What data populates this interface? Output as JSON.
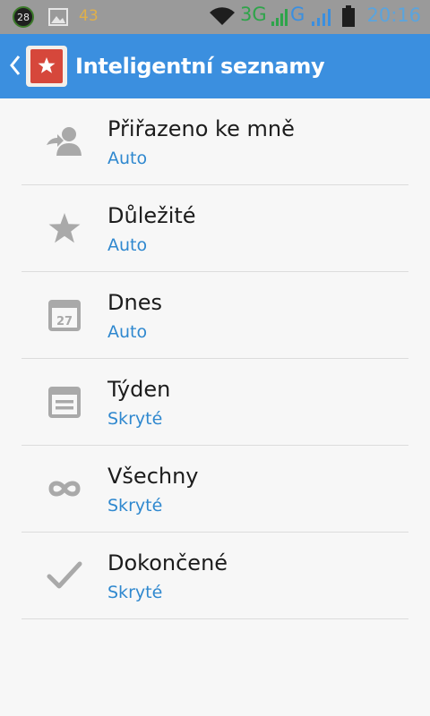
{
  "status_bar": {
    "notification_count": "28",
    "battery_level_text": "43",
    "network_3g": "3G",
    "network_g": "G",
    "time": "20:16"
  },
  "app_bar": {
    "title": "Inteligentní seznamy"
  },
  "list": {
    "items": [
      {
        "title": "Přiřazeno ke mně",
        "subtitle": "Auto",
        "icon": "assigned-to-me-icon"
      },
      {
        "title": "Důležité",
        "subtitle": "Auto",
        "icon": "star-icon"
      },
      {
        "title": "Dnes",
        "subtitle": "Auto",
        "icon": "calendar-today-icon",
        "icon_text": "27"
      },
      {
        "title": "Týden",
        "subtitle": "Skryté",
        "icon": "calendar-week-icon"
      },
      {
        "title": "Všechny",
        "subtitle": "Skryté",
        "icon": "infinity-icon"
      },
      {
        "title": "Dokončené",
        "subtitle": "Skryté",
        "icon": "checkmark-icon"
      }
    ]
  },
  "colors": {
    "status_bar": "#9a9a9a",
    "app_bar": "#3b8fdf",
    "subtitle": "#2f88cf",
    "icon_gray": "#a9a9a9",
    "background": "#f7f7f7"
  }
}
